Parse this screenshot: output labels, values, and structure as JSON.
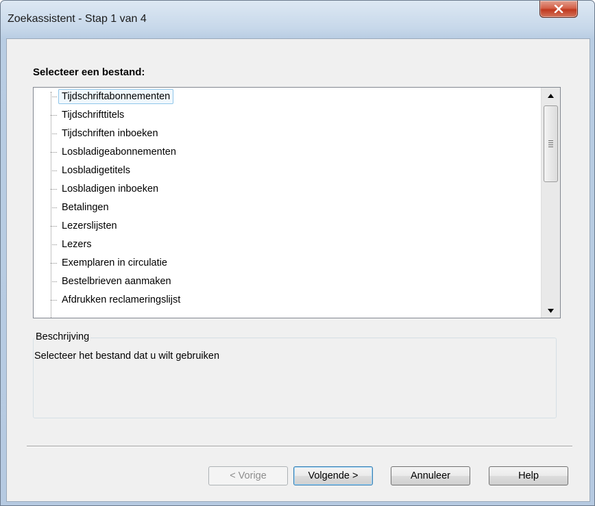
{
  "window": {
    "title": "Zoekassistent - Stap 1 van 4",
    "close_icon": "close-icon"
  },
  "main": {
    "section_label": "Selecteer een bestand:",
    "tree_items": [
      "Tijdschriftabonnementen",
      "Tijdschrifttitels",
      "Tijdschriften inboeken",
      "Losbladigeabonnementen",
      "Losbladigetitels",
      "Losbladigen inboeken",
      "Betalingen",
      "Lezerslijsten",
      "Lezers",
      "Exemplaren in circulatie",
      "Bestelbrieven aanmaken",
      "Afdrukken reclameringslijst"
    ],
    "selected_index": 0,
    "description": {
      "legend": "Beschrijving",
      "text": "Selecteer het bestand dat u wilt gebruiken"
    }
  },
  "buttons": {
    "previous": "< Vorige",
    "next": "Volgende >",
    "cancel": "Annuleer",
    "help": "Help"
  },
  "colors": {
    "close_button": "#c0391f",
    "selection_border": "#8fc6ea",
    "default_button_border": "#3c7fb1"
  }
}
